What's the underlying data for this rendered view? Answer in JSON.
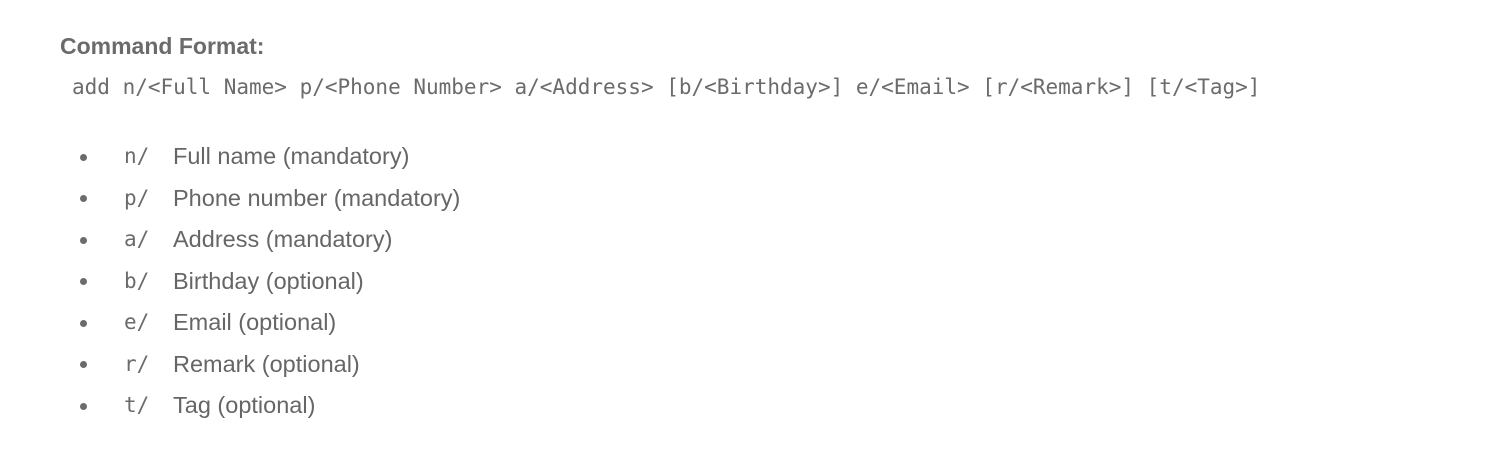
{
  "heading": "Command Format:",
  "command": "add n/<Full Name> p/<Phone Number> a/<Address> [b/<Birthday>] e/<Email> [r/<Remark>] [t/<Tag>]",
  "params": [
    {
      "prefix": "n/",
      "description": "Full name (mandatory)"
    },
    {
      "prefix": "p/",
      "description": "Phone number (mandatory)"
    },
    {
      "prefix": "a/",
      "description": "Address (mandatory)"
    },
    {
      "prefix": "b/",
      "description": "Birthday (optional)"
    },
    {
      "prefix": "e/",
      "description": "Email (optional)"
    },
    {
      "prefix": "r/",
      "description": "Remark (optional)"
    },
    {
      "prefix": "t/",
      "description": "Tag (optional)"
    }
  ]
}
